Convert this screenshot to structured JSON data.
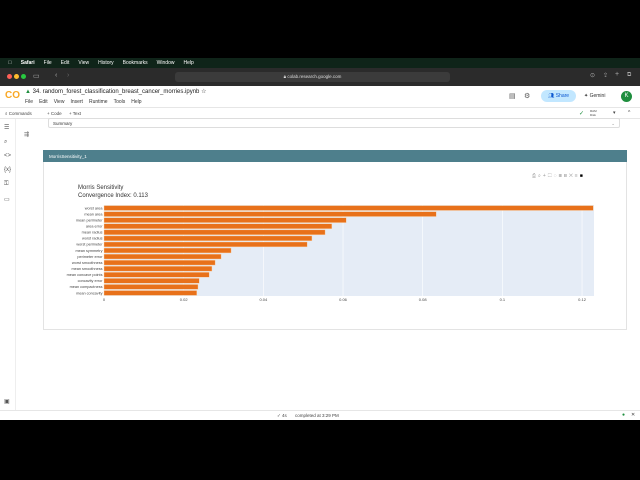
{
  "menubar": {
    "items": [
      "Safari",
      "File",
      "Edit",
      "View",
      "History",
      "Bookmarks",
      "Window",
      "Help"
    ]
  },
  "browser": {
    "url": "colab.research.google.com"
  },
  "colab": {
    "logo": "CO",
    "title": "34. random_forest_classification_breast_cancer_morries.ipynb",
    "menus": [
      "File",
      "Edit",
      "View",
      "Insert",
      "Runtime",
      "Tools",
      "Help"
    ],
    "share_label": "Share",
    "gemini_label": "Gemini",
    "avatar": "K",
    "ram_label": "RAM",
    "disk_label": "Disk"
  },
  "toolbar": {
    "commands": "Commands",
    "code": "+ Code",
    "text": "+ Text"
  },
  "summary_select": "Summary",
  "panel": {
    "title": "MorrisSensitivity_1"
  },
  "status": {
    "time": "4s",
    "completed": "completed at 3:29 PM"
  },
  "chart_data": {
    "type": "bar",
    "orientation": "horizontal",
    "title": "Morris Sensitivity",
    "subtitle": "Convergence Index: 0.113",
    "categories": [
      "worst area",
      "mean area",
      "mean perimeter",
      "area error",
      "mean radius",
      "worst radius",
      "worst perimeter",
      "mean symmetry",
      "perimeter error",
      "worst smoothness",
      "mean smoothness",
      "mean concave points",
      "concavity error",
      "mean compactness",
      "mean concavity"
    ],
    "values": [
      0.1228,
      0.0834,
      0.0608,
      0.0572,
      0.0555,
      0.0522,
      0.051,
      0.0319,
      0.0294,
      0.0279,
      0.0271,
      0.0264,
      0.0239,
      0.0236,
      0.0233
    ],
    "xticks": [
      "0",
      "0.02",
      "0.04",
      "0.06",
      "0.08",
      "0.1",
      "0.12"
    ],
    "xlim": [
      0,
      0.123
    ],
    "bar_color": "#e8711a",
    "plot_bg": "#e5ecf6",
    "grid": true
  }
}
